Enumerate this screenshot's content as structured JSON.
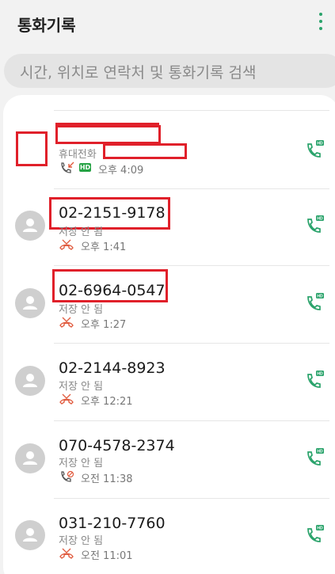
{
  "header": {
    "title": "통화기록",
    "more_icon": "more-vertical-icon"
  },
  "search": {
    "placeholder": "시간, 위치로 연락처 및 통화기록 검색"
  },
  "colors": {
    "accent": "#2aa36b",
    "missed": "#e0593c",
    "redaction": "#e0202a"
  },
  "calls": [
    {
      "name": "",
      "subtitle": "휴대전화",
      "type": "incoming",
      "hd": true,
      "time": "오후 4:09",
      "redacted": true
    },
    {
      "name": "02-2151-9178",
      "subtitle": "저장 안 됨",
      "type": "missed",
      "hd": false,
      "time": "오후 1:41",
      "redacted": false
    },
    {
      "name": "02-6964-0547",
      "subtitle": "저장 안 됨",
      "type": "missed",
      "hd": false,
      "time": "오후 1:27",
      "redacted": false
    },
    {
      "name": "02-2144-8923",
      "subtitle": "저장 안 됨",
      "type": "missed",
      "hd": false,
      "time": "오후 12:21",
      "redacted": false
    },
    {
      "name": "070-4578-2374",
      "subtitle": "저장 안 됨",
      "type": "rejected",
      "hd": false,
      "time": "오전 11:38",
      "redacted": false
    },
    {
      "name": "031-210-7760",
      "subtitle": "저장 안 됨",
      "type": "missed",
      "hd": false,
      "time": "오전 11:01",
      "redacted": false
    }
  ]
}
